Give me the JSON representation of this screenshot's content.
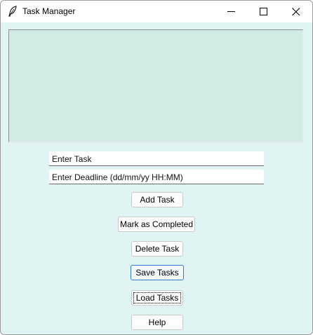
{
  "window": {
    "title": "Task Manager",
    "icon": "feather-icon",
    "controls": [
      "minimize-icon",
      "maximize-icon",
      "close-icon"
    ]
  },
  "task_list": {
    "items": []
  },
  "inputs": {
    "task_value": "Enter Task",
    "deadline_value": "Enter Deadline (dd/mm/yy HH:MM)"
  },
  "buttons": {
    "add": "Add Task",
    "complete": "Mark as Completed",
    "delete": "Delete Task",
    "save": "Save Tasks",
    "load": "Load Tasks",
    "help": "Help"
  },
  "colors": {
    "window_background": "#e0f4f3",
    "listbox_background": "#d2ebe5",
    "focused_button_border": "#2f7bd0"
  }
}
